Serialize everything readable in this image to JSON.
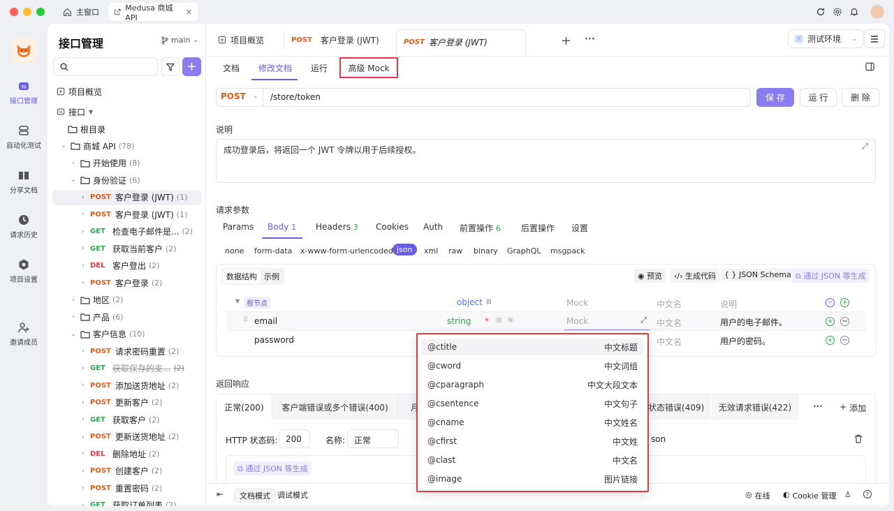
{
  "window": {
    "home_tab": "主窗口",
    "project_tab": "Medusa 商城 API"
  },
  "rail": {
    "items": [
      {
        "label": "接口管理"
      },
      {
        "label": "自动化测试"
      },
      {
        "label": "分享文档"
      },
      {
        "label": "请求历史"
      },
      {
        "label": "项目设置"
      },
      {
        "label": "邀请成员"
      }
    ]
  },
  "tree": {
    "title": "接口管理",
    "branch": "main",
    "search_placeholder": "",
    "overview": "项目概览",
    "interfaces": "接口",
    "root": "根目录",
    "items": [
      {
        "kind": "folder",
        "label": "商城 API",
        "count": "(78)",
        "depth": 1,
        "open": true
      },
      {
        "kind": "folder",
        "label": "开始使用",
        "count": "(8)",
        "depth": 2,
        "open": false
      },
      {
        "kind": "folder",
        "label": "身份验证",
        "count": "(6)",
        "depth": 2,
        "open": true
      },
      {
        "kind": "api",
        "method": "POST",
        "label": "客户登录 (JWT)",
        "count": "(1)",
        "depth": 3,
        "selected": true
      },
      {
        "kind": "api",
        "method": "POST",
        "label": "客户登录 (JWT)",
        "count": "(1)",
        "depth": 3
      },
      {
        "kind": "api",
        "method": "GET",
        "label": "检查电子邮件是...",
        "count": "(2)",
        "depth": 3
      },
      {
        "kind": "api",
        "method": "GET",
        "label": "获取当前客户",
        "count": "(2)",
        "depth": 3
      },
      {
        "kind": "api",
        "method": "DEL",
        "label": "客户登出",
        "count": "(2)",
        "depth": 3
      },
      {
        "kind": "api",
        "method": "POST",
        "label": "客户登录",
        "count": "(2)",
        "depth": 3
      },
      {
        "kind": "folder",
        "label": "地区",
        "count": "(2)",
        "depth": 2,
        "open": false
      },
      {
        "kind": "folder",
        "label": "产品",
        "count": "(6)",
        "depth": 2,
        "open": false
      },
      {
        "kind": "folder",
        "label": "客户信息",
        "count": "(10)",
        "depth": 2,
        "open": true
      },
      {
        "kind": "api",
        "method": "POST",
        "label": "请求密码重置",
        "count": "(2)",
        "depth": 3
      },
      {
        "kind": "api",
        "method": "GET",
        "label": "获取保存的支...",
        "count": "(2)",
        "depth": 3,
        "strike": true
      },
      {
        "kind": "api",
        "method": "POST",
        "label": "添加送货地址",
        "count": "(2)",
        "depth": 3
      },
      {
        "kind": "api",
        "method": "POST",
        "label": "更新客户",
        "count": "(2)",
        "depth": 3
      },
      {
        "kind": "api",
        "method": "GET",
        "label": "获取客户",
        "count": "(2)",
        "depth": 3
      },
      {
        "kind": "api",
        "method": "POST",
        "label": "更新送货地址",
        "count": "(2)",
        "depth": 3
      },
      {
        "kind": "api",
        "method": "DEL",
        "label": "删除地址",
        "count": "(2)",
        "depth": 3
      },
      {
        "kind": "api",
        "method": "POST",
        "label": "创建客户",
        "count": "(2)",
        "depth": 3
      },
      {
        "kind": "api",
        "method": "POST",
        "label": "重置密码",
        "count": "(2)",
        "depth": 3
      },
      {
        "kind": "api",
        "method": "GET",
        "label": "获取订单列表",
        "count": "(2)",
        "depth": 3
      }
    ]
  },
  "tabs": {
    "overview": "项目概览",
    "t1_method": "POST",
    "t1_label": "客户登录 (JWT)",
    "t2_method": "POST",
    "t2_label": "客户登录 (JWT)",
    "add": "+",
    "more": "···",
    "env": "测试环境"
  },
  "subtabs": [
    "文档",
    "修改文档",
    "运行",
    "高级 Mock"
  ],
  "request": {
    "method": "POST",
    "path": "/store/token",
    "save": "保 存",
    "run": "运 行",
    "delete": "删 除"
  },
  "description": {
    "label": "说明",
    "text": "成功登录后，将返回一个 JWT 令牌以用于后续授权。"
  },
  "params": {
    "title": "请求参数",
    "tabs": [
      {
        "label": "Params",
        "badge": ""
      },
      {
        "label": "Body",
        "badge": "1"
      },
      {
        "label": "Headers",
        "badge": "3"
      },
      {
        "label": "Cookies",
        "badge": ""
      },
      {
        "label": "Auth",
        "badge": ""
      },
      {
        "label": "前置操作",
        "badge": "6"
      },
      {
        "label": "后置操作",
        "badge": ""
      },
      {
        "label": "设置",
        "badge": ""
      }
    ],
    "body_types": [
      "none",
      "form-data",
      "x-www-form-urlencoded",
      "json",
      "xml",
      "raw",
      "binary",
      "GraphQL",
      "msgpack"
    ],
    "structure_tab": "数据结构",
    "example_tab": "示例",
    "preview": "预览",
    "gen_code": "生成代码",
    "json_schema": "JSON Schema",
    "gen_from_json": "通过 JSON 等生成",
    "rows": [
      {
        "name": "根节点",
        "type": "object",
        "mock": "Mock",
        "cn": "中文名",
        "desc": "说明"
      },
      {
        "name": "email",
        "type": "string",
        "mock": "Mock",
        "cn": "中文名",
        "desc": "用户的电子邮件。"
      },
      {
        "name": "password",
        "type": "",
        "mock": "",
        "cn": "中文名",
        "desc": "用户的密码。"
      }
    ]
  },
  "response": {
    "title": "返回响应",
    "tabs": [
      "正常(200)",
      "客户端错误或多个错误(400)",
      "月",
      "状态错误(409)",
      "无效请求错误(422)"
    ],
    "more": "···",
    "add": "添加",
    "status_label": "HTTP 状态码:",
    "status_value": "200",
    "name_label": "名称:",
    "name_value": "正常",
    "type_tail": "son",
    "gen_from_json": "通过 JSON 等生成"
  },
  "mock_dropdown": [
    {
      "code": "@ctitle",
      "desc": "中文标题"
    },
    {
      "code": "@cword",
      "desc": "中文词组"
    },
    {
      "code": "@cparagraph",
      "desc": "中文大段文本"
    },
    {
      "code": "@csentence",
      "desc": "中文句子"
    },
    {
      "code": "@cname",
      "desc": "中文姓名"
    },
    {
      "code": "@cfirst",
      "desc": "中文姓"
    },
    {
      "code": "@clast",
      "desc": "中文名"
    },
    {
      "code": "@image",
      "desc": "图片链接"
    }
  ],
  "footer": {
    "doc_mode": "文档模式",
    "debug_mode": "调试模式",
    "online": "在线",
    "cookie": "Cookie 管理"
  },
  "colors": {
    "accent": "#8b7cf0",
    "post": "#e35b1c",
    "get": "#2fa84f",
    "del": "#e0393e",
    "highlight_border": "#e0393e"
  }
}
